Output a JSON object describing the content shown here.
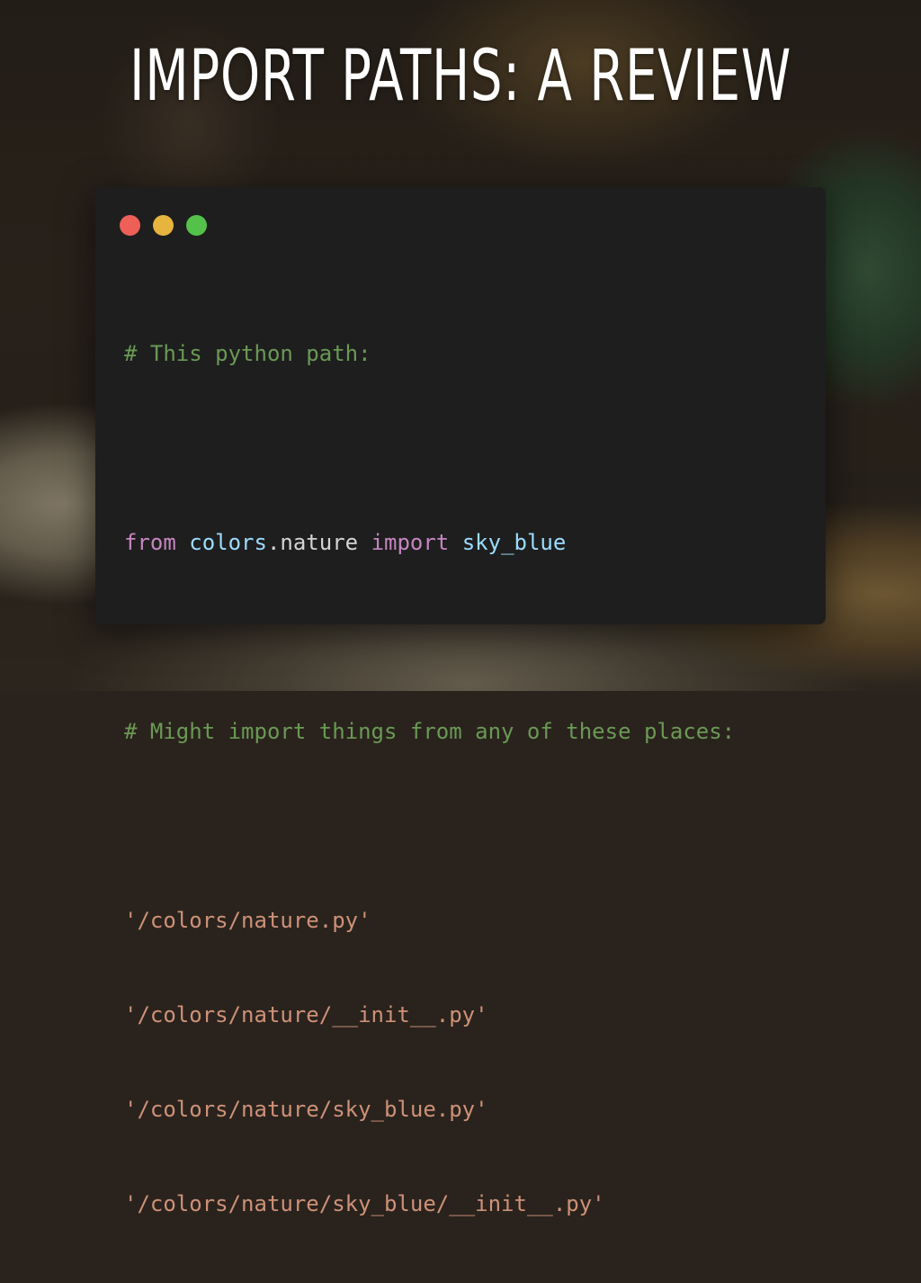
{
  "slide": {
    "title": "IMPORT PATHS: A REVIEW"
  },
  "code_window": {
    "controls": {
      "close_color": "#ed5f57",
      "minimize_color": "#e6b43f",
      "maximize_color": "#54c24a"
    },
    "comment1": "# This python path:",
    "import_line": {
      "kw_from": "from",
      "module": "colors",
      "dot": ".",
      "submodule": "nature",
      "kw_import": "import",
      "name": "sky_blue"
    },
    "comment2": "# Might import things from any of these places:",
    "paths": [
      "'/colors/nature.py'",
      "'/colors/nature/__init__.py'",
      "'/colors/nature/sky_blue.py'",
      "'/colors/nature/sky_blue/__init__.py'"
    ]
  },
  "colors": {
    "comment": "#6a9955",
    "keyword": "#c586c0",
    "identifier": "#9cdcfe",
    "string": "#ce9178",
    "card_background": "#1e1e1e"
  }
}
